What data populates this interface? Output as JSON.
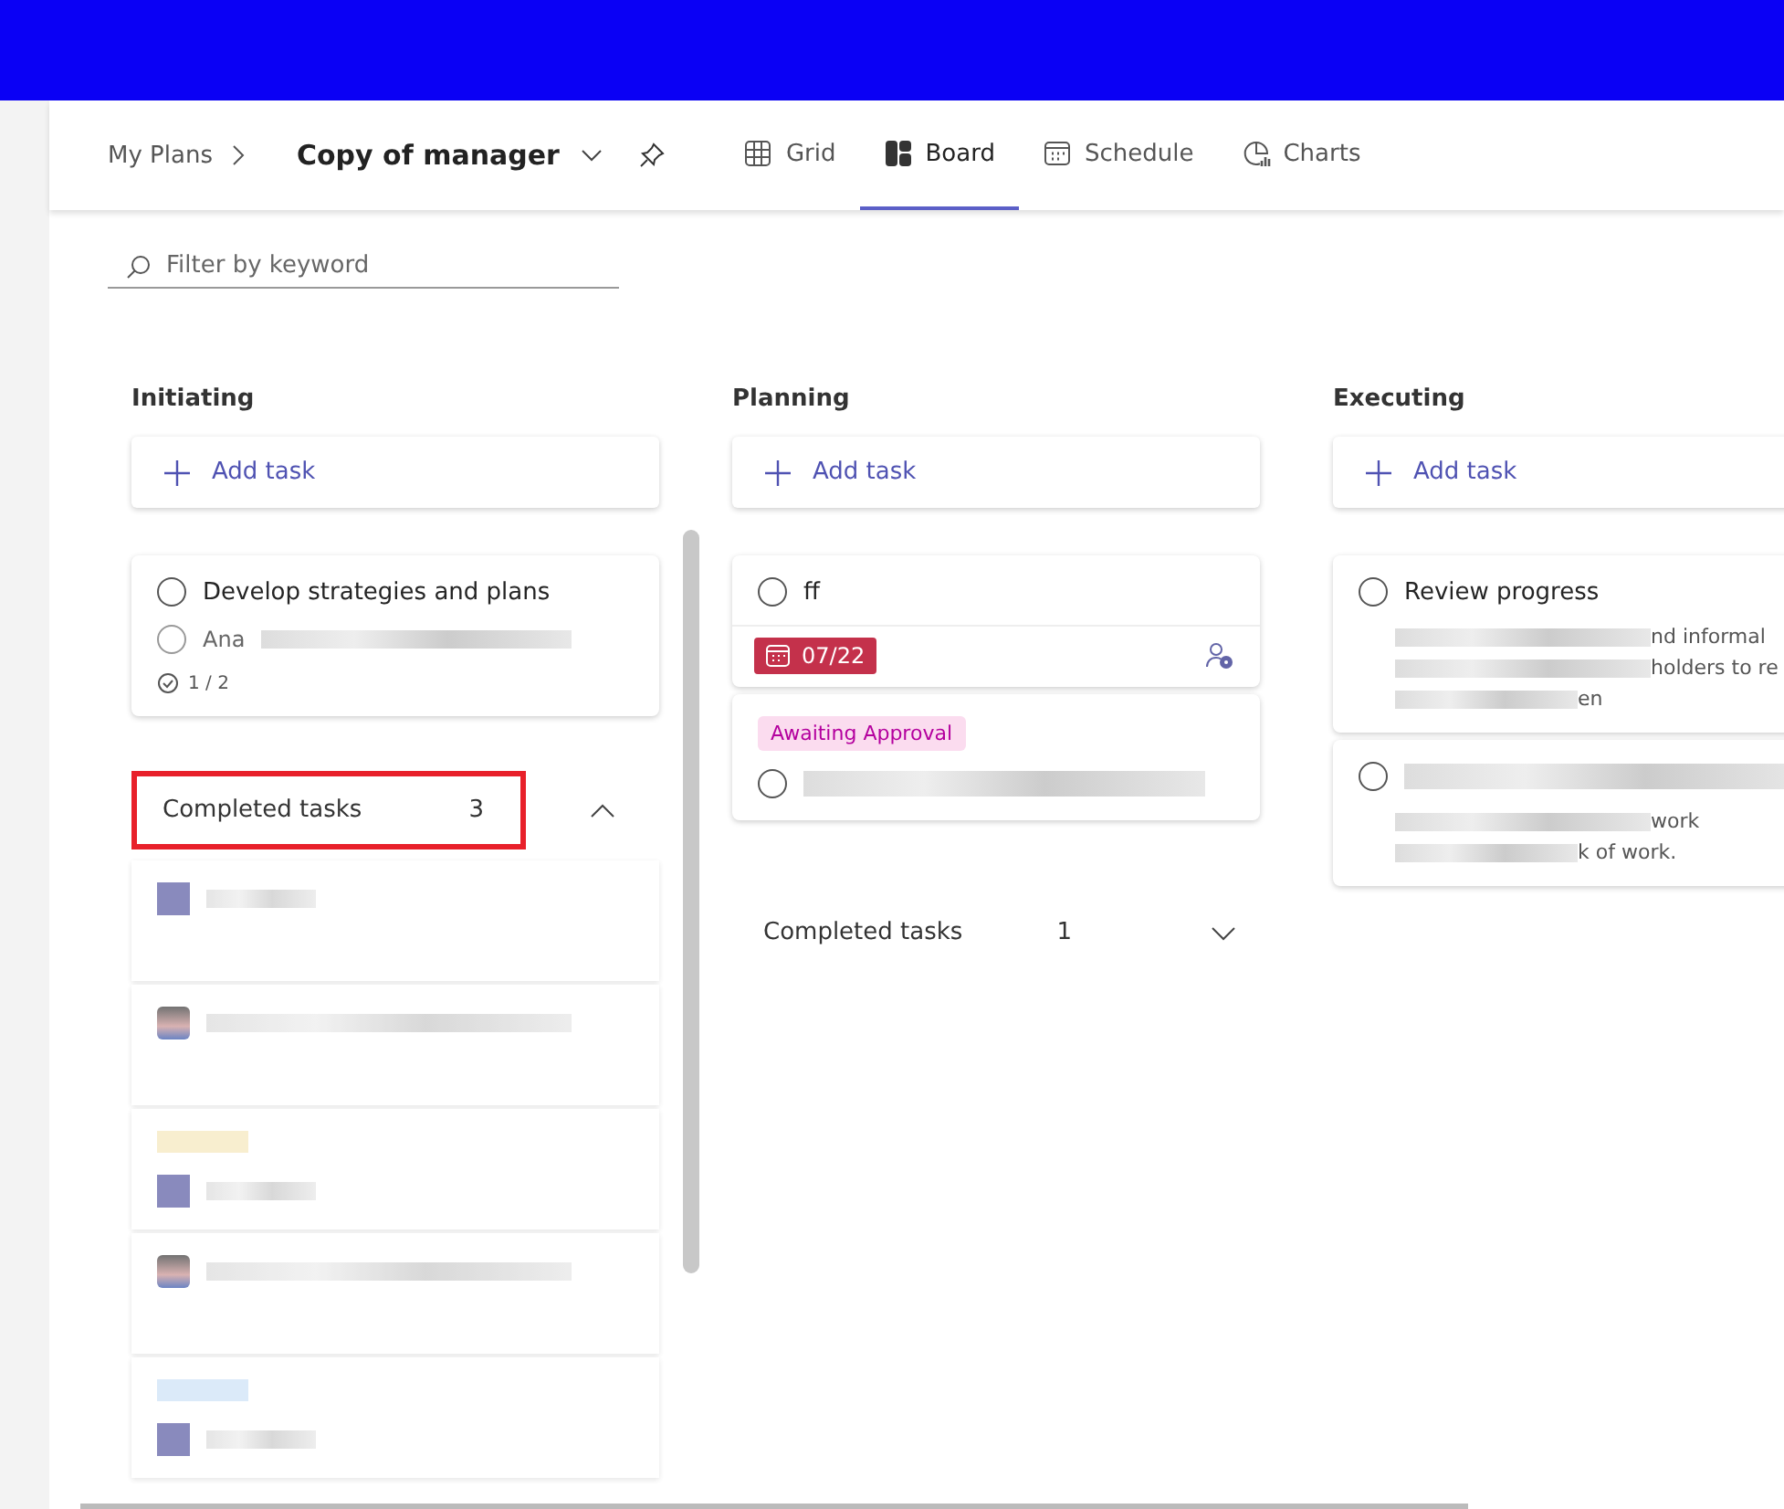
{
  "header": {
    "breadcrumb": "My Plans",
    "plan_title": "Copy of manager",
    "pinned": false
  },
  "tabs": [
    {
      "label": "Grid",
      "kind": "grid",
      "selected": false
    },
    {
      "label": "Board",
      "kind": "board",
      "selected": true
    },
    {
      "label": "Schedule",
      "kind": "schedule",
      "selected": false
    },
    {
      "label": "Charts",
      "kind": "charts",
      "selected": false
    }
  ],
  "filter": {
    "placeholder": "Filter by keyword"
  },
  "columns": [
    {
      "title": "Initiating",
      "add_label": "Add task",
      "cards": [
        {
          "kind": "task",
          "title": "Develop strategies and plans",
          "subtasks": [
            {
              "text": "Ana",
              "done": false
            }
          ],
          "checklist": "1 / 2"
        }
      ],
      "completed": {
        "label": "Completed tasks",
        "count": "3",
        "expanded": true,
        "highlighted": true,
        "cards": [
          {
            "kind": "plain"
          },
          {
            "kind": "photo"
          },
          {
            "kind": "tagged"
          },
          {
            "kind": "photo"
          },
          {
            "kind": "tagged"
          }
        ]
      }
    },
    {
      "title": "Planning",
      "add_label": "Add task",
      "cards": [
        {
          "kind": "task",
          "title": "ff",
          "due": "07/22",
          "overdue": true,
          "assign": true
        },
        {
          "kind": "task",
          "label": {
            "text": "Awaiting Approval",
            "color": "#fbdcef"
          },
          "title_blurred": true
        }
      ],
      "completed": {
        "label": "Completed tasks",
        "count": "1",
        "expanded": false,
        "highlighted": false
      }
    },
    {
      "title": "Executing",
      "add_label": "Add task",
      "cards": [
        {
          "kind": "task",
          "title": "Review progress",
          "notes": [
            "nd informal",
            "holders to re",
            "en"
          ]
        },
        {
          "kind": "task",
          "title_blurred": true,
          "notes": [
            "work",
            "k of work."
          ]
        }
      ]
    }
  ]
}
